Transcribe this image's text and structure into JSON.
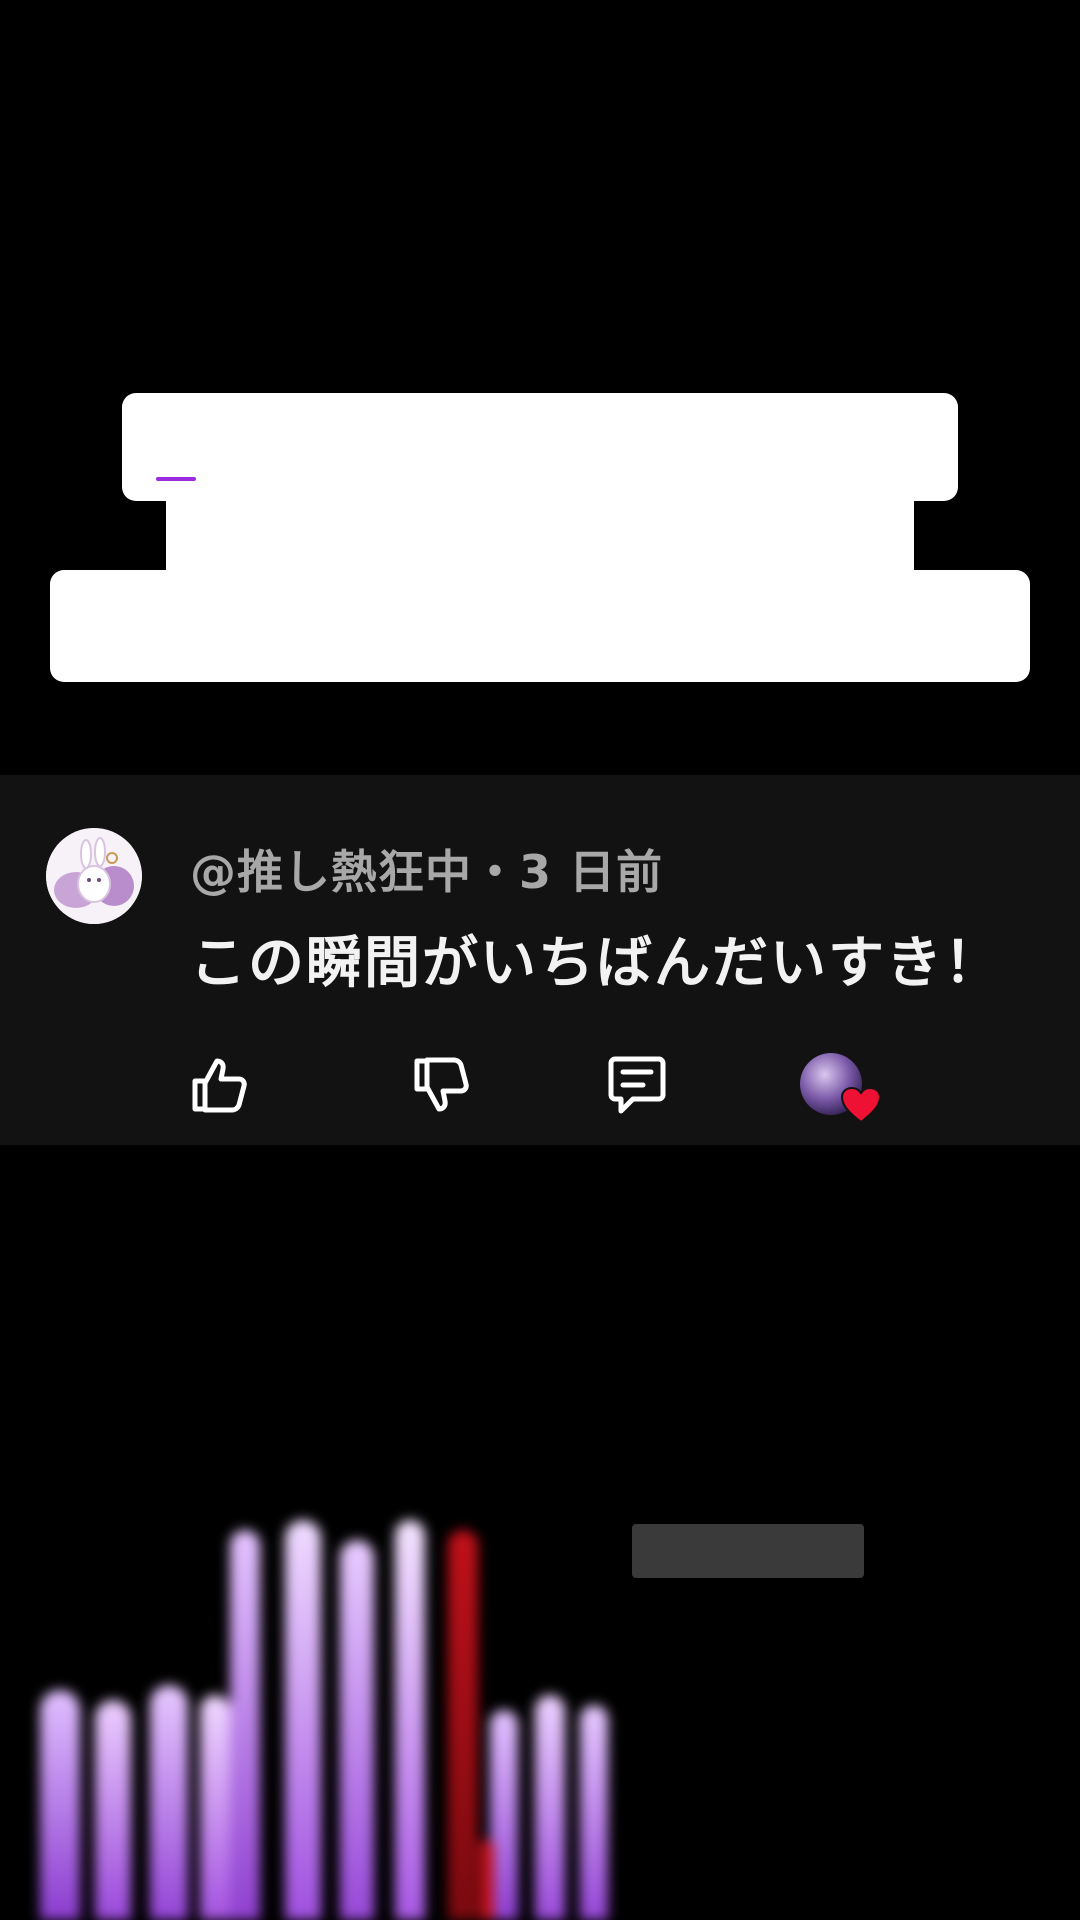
{
  "caption": {
    "caret_color": "#9b2be0"
  },
  "comment": {
    "author_meta": "@推し熱狂中・3 日前",
    "text": "この瞬間がいちばんだいすき！",
    "avatar_icon": "bunny-avatar-icon",
    "actions": {
      "like_icon": "thumbs-up-icon",
      "dislike_icon": "thumbs-down-icon",
      "reply_icon": "reply-comment-icon",
      "creator_heart_icon": "creator-heart-icon"
    },
    "colors": {
      "card_bg": "#121212",
      "meta": "#a8a8a8",
      "text": "#f2f2f2",
      "heart": "#ee1133"
    }
  },
  "video": {
    "accent_purple": "#b46be8",
    "accent_red": "#c0101a"
  }
}
